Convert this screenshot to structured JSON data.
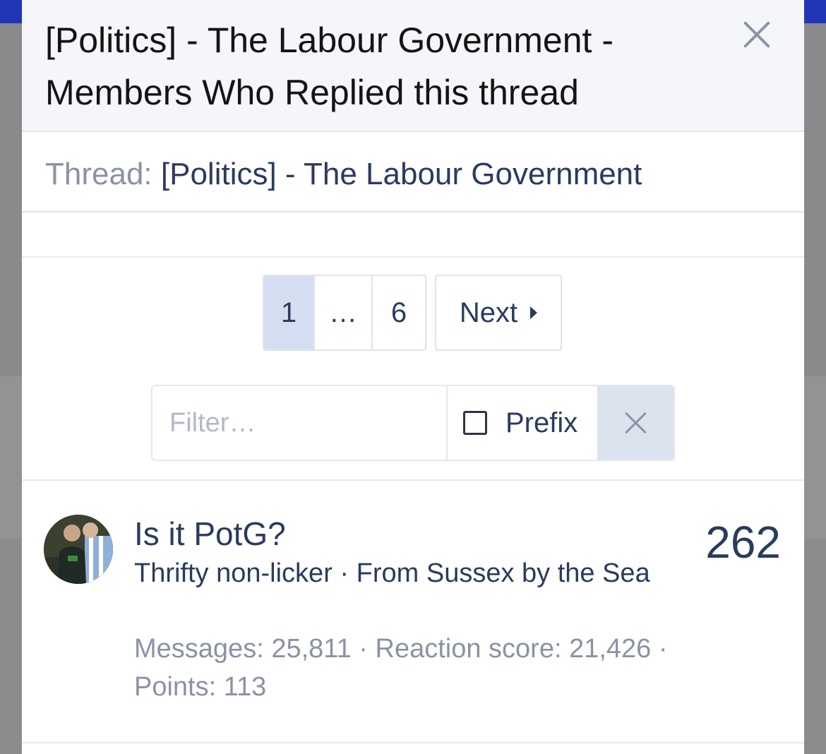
{
  "modal": {
    "title": "[Politics] - The Labour Government - Members Who Replied this thread"
  },
  "thread": {
    "label": "Thread:",
    "name": "[Politics] - The Labour Government"
  },
  "pagination": {
    "current": "1",
    "ellipsis": "…",
    "last": "6",
    "next": "Next"
  },
  "filter": {
    "placeholder": "Filter…",
    "prefix_label": "Prefix"
  },
  "member": {
    "name": "Is it PotG?",
    "title": "Thrifty non-licker",
    "from_label": "From",
    "location": "Sussex by the Sea",
    "messages_label": "Messages:",
    "messages": "25,811",
    "reaction_label": "Reaction score:",
    "reaction_score": "21,426",
    "points_label": "Points:",
    "points": "113",
    "reply_count": "262"
  }
}
